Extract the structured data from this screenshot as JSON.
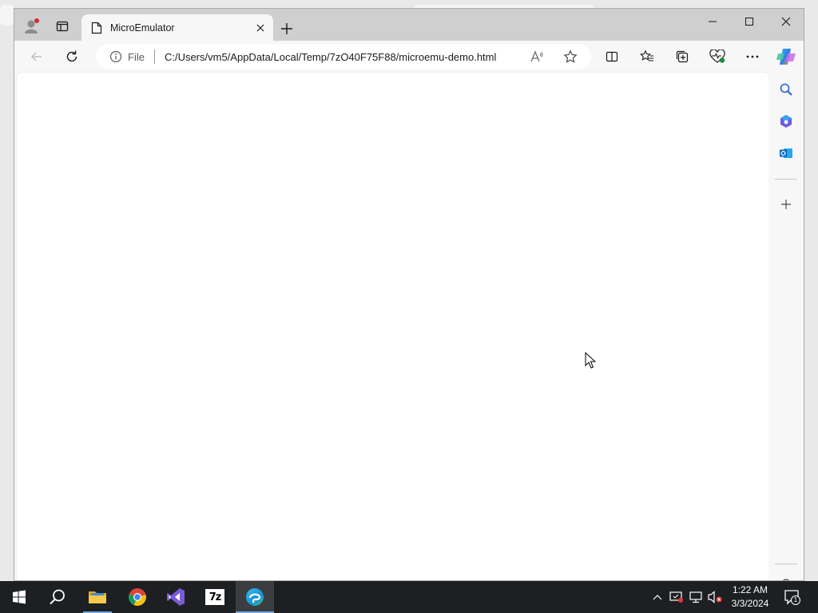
{
  "browser": {
    "tab": {
      "title": "MicroEmulator",
      "icon": "page-icon"
    },
    "toolbar": {
      "file_label": "File",
      "url": "C:/Users/vm5/AppData/Local/Temp/7zO40F75F88/microemu-demo.html"
    },
    "sidebar": {
      "items": [
        "search-icon",
        "copilot-m365-icon",
        "outlook-icon",
        "add-icon",
        "settings-icon"
      ]
    }
  },
  "taskbar": {
    "apps": [
      "start",
      "search",
      "file-explorer",
      "chrome",
      "visual-studio",
      "7-zip",
      "edge"
    ],
    "app_7zip_label": "7z",
    "clock": {
      "time": "1:22 AM",
      "date": "3/3/2024"
    },
    "notifications": "1"
  },
  "colors": {
    "accent": "#6aa7e8",
    "taskbar": "#1d1f22",
    "titlebar": "#cfcfcf"
  }
}
